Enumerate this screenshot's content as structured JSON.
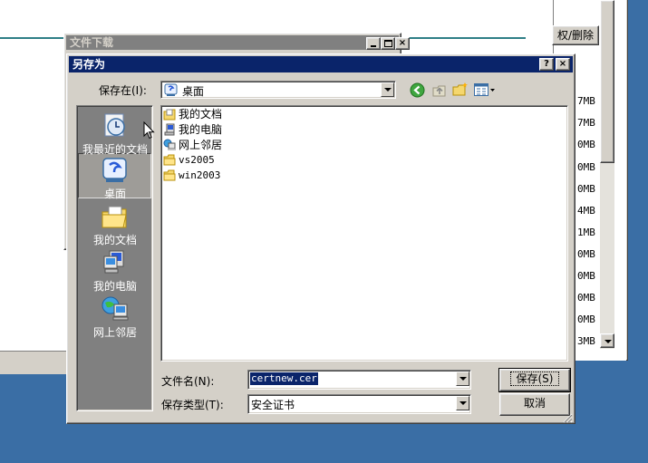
{
  "bg_window": {
    "button_label": "权/删除",
    "sizes": [
      "7MB",
      "7MB",
      "0MB",
      "0MB",
      "0MB",
      "4MB",
      "1MB",
      "0MB",
      "0MB",
      "0MB",
      "0MB",
      "3MB"
    ]
  },
  "download_window": {
    "title": "文件下载"
  },
  "dialog": {
    "title": "另存为",
    "save_in_label": "保存在(I):",
    "save_in_value": "桌面",
    "places": [
      {
        "label": "我最近的文档",
        "icon": "recent-docs-icon"
      },
      {
        "label": "桌面",
        "icon": "desktop-icon"
      },
      {
        "label": "我的文档",
        "icon": "my-documents-icon"
      },
      {
        "label": "我的电脑",
        "icon": "my-computer-icon"
      },
      {
        "label": "网上邻居",
        "icon": "network-places-icon"
      }
    ],
    "files": [
      {
        "name": "我的文档",
        "icon": "my-documents-icon"
      },
      {
        "name": "我的电脑",
        "icon": "my-computer-icon"
      },
      {
        "name": "网上邻居",
        "icon": "network-places-icon"
      },
      {
        "name": "vs2005",
        "icon": "folder-icon"
      },
      {
        "name": "win2003",
        "icon": "folder-icon"
      }
    ],
    "filename_label": "文件名(N):",
    "filename_value": "certnew.cer",
    "filetype_label": "保存类型(T):",
    "filetype_value": "安全证书",
    "save_button": "保存(S)",
    "cancel_button": "取消",
    "help_button": "?",
    "close_button": "×"
  },
  "colors": {
    "desktop": "#3a6ea5",
    "active_title": "#0a246a",
    "inactive_title": "#808080",
    "places_bar": "#808080",
    "selection": "#0a246a"
  }
}
